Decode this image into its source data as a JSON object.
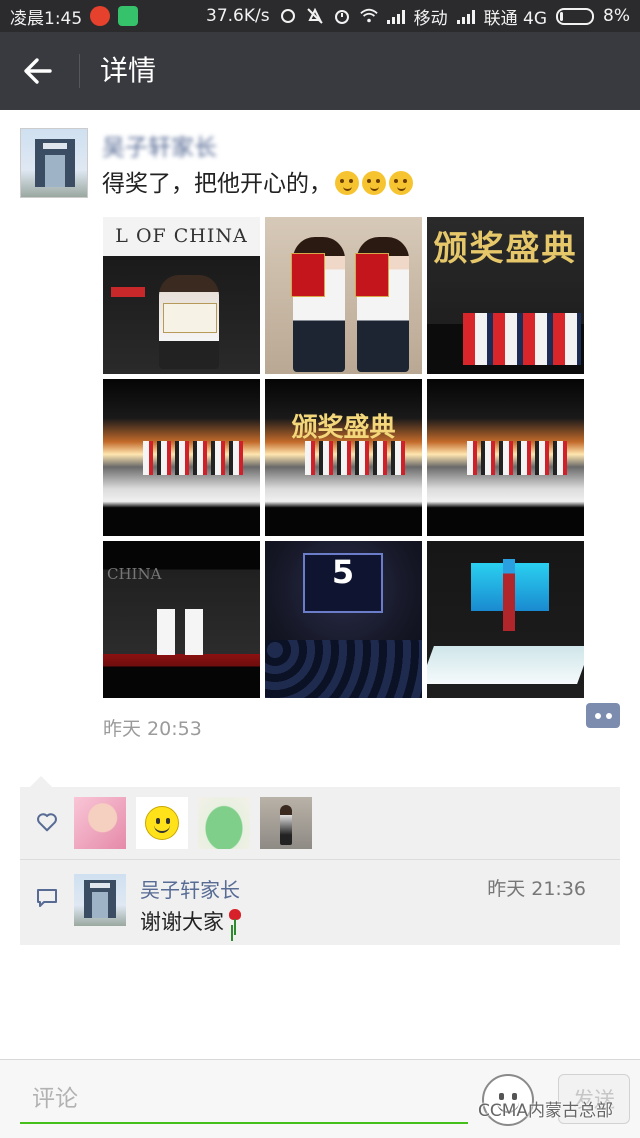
{
  "status_bar": {
    "time": "凌晨1:45",
    "net_speed": "37.6K/s",
    "carrier1": "移动",
    "carrier2": "联通 4G",
    "battery": "8%"
  },
  "nav": {
    "title": "详情",
    "back_icon": "arrow-left-icon"
  },
  "post": {
    "author": "吴子轩家长",
    "text": "得奖了，把他开心的，",
    "emoji_icon": "thinking-face-icon",
    "emoji_count": 3,
    "photos": [
      {
        "caption": "L OF CHINA"
      },
      {
        "caption": ""
      },
      {
        "caption": "颁奖盛典"
      },
      {
        "caption": ""
      },
      {
        "caption": "颁奖盛典"
      },
      {
        "caption": ""
      },
      {
        "caption": "CHINA"
      },
      {
        "caption": "5"
      },
      {
        "caption": ""
      }
    ],
    "time": "昨天 20:53"
  },
  "likes": {
    "icon": "heart-outline-icon",
    "count": 4
  },
  "comments": [
    {
      "name": "吴子轩家长",
      "time": "昨天 21:36",
      "text": "谢谢大家",
      "emoji": "rose-icon"
    }
  ],
  "input": {
    "placeholder": "评论",
    "send_label": "发送"
  },
  "watermark": "CCMA内蒙古总部",
  "colors": {
    "nav_bg": "#393a3f",
    "status_bg": "#2b2b2d",
    "link": "#576b95",
    "accent_green": "#45c01a"
  }
}
